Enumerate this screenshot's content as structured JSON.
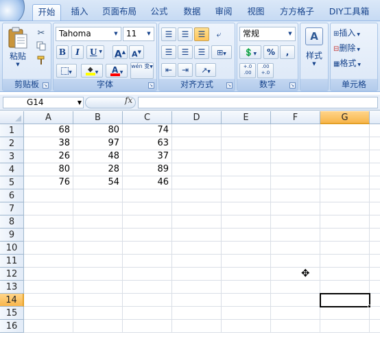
{
  "tabs": [
    {
      "label": "开始",
      "active": true
    },
    {
      "label": "插入"
    },
    {
      "label": "页面布局"
    },
    {
      "label": "公式"
    },
    {
      "label": "数据"
    },
    {
      "label": "审阅"
    },
    {
      "label": "视图"
    },
    {
      "label": "方方格子"
    },
    {
      "label": "DIY工具箱"
    }
  ],
  "ribbon": {
    "clipboard": {
      "paste_label": "粘贴",
      "group_label": "剪贴板"
    },
    "font": {
      "font_name": "Tahoma",
      "font_size": "11",
      "bold": "B",
      "italic": "I",
      "underline": "U",
      "grow_font": "A",
      "shrink_font": "A",
      "font_color_glyph": "A",
      "phonetic_glyph": "wén 变",
      "group_label": "字体"
    },
    "alignment": {
      "group_label": "对齐方式"
    },
    "number": {
      "format": "常规",
      "percent": "%",
      "comma": ",",
      "inc_decimal": "+.0 .00",
      "dec_decimal": ".00 +.0",
      "group_label": "数字"
    },
    "styles": {
      "label": "样式"
    },
    "cells": {
      "insert": "插入",
      "delete": "删除",
      "format": "格式",
      "group_label": "单元格"
    }
  },
  "formula_bar": {
    "name_box": "G14",
    "fx": "fx",
    "formula": ""
  },
  "columns": [
    "A",
    "B",
    "C",
    "D",
    "E",
    "F",
    "G"
  ],
  "selected_column": "G",
  "rows": [
    "1",
    "2",
    "3",
    "4",
    "5",
    "6",
    "7",
    "8",
    "9",
    "10",
    "11",
    "12",
    "13",
    "14",
    "15",
    "16"
  ],
  "selected_row": "14",
  "cells": [
    [
      "68",
      "80",
      "74"
    ],
    [
      "38",
      "97",
      "63"
    ],
    [
      "26",
      "48",
      "37"
    ],
    [
      "80",
      "28",
      "89"
    ],
    [
      "76",
      "54",
      "46"
    ]
  ],
  "colors": {
    "accent": "#15428b",
    "selected_header": "#f8b64c",
    "grid_line": "#d9dee6"
  }
}
